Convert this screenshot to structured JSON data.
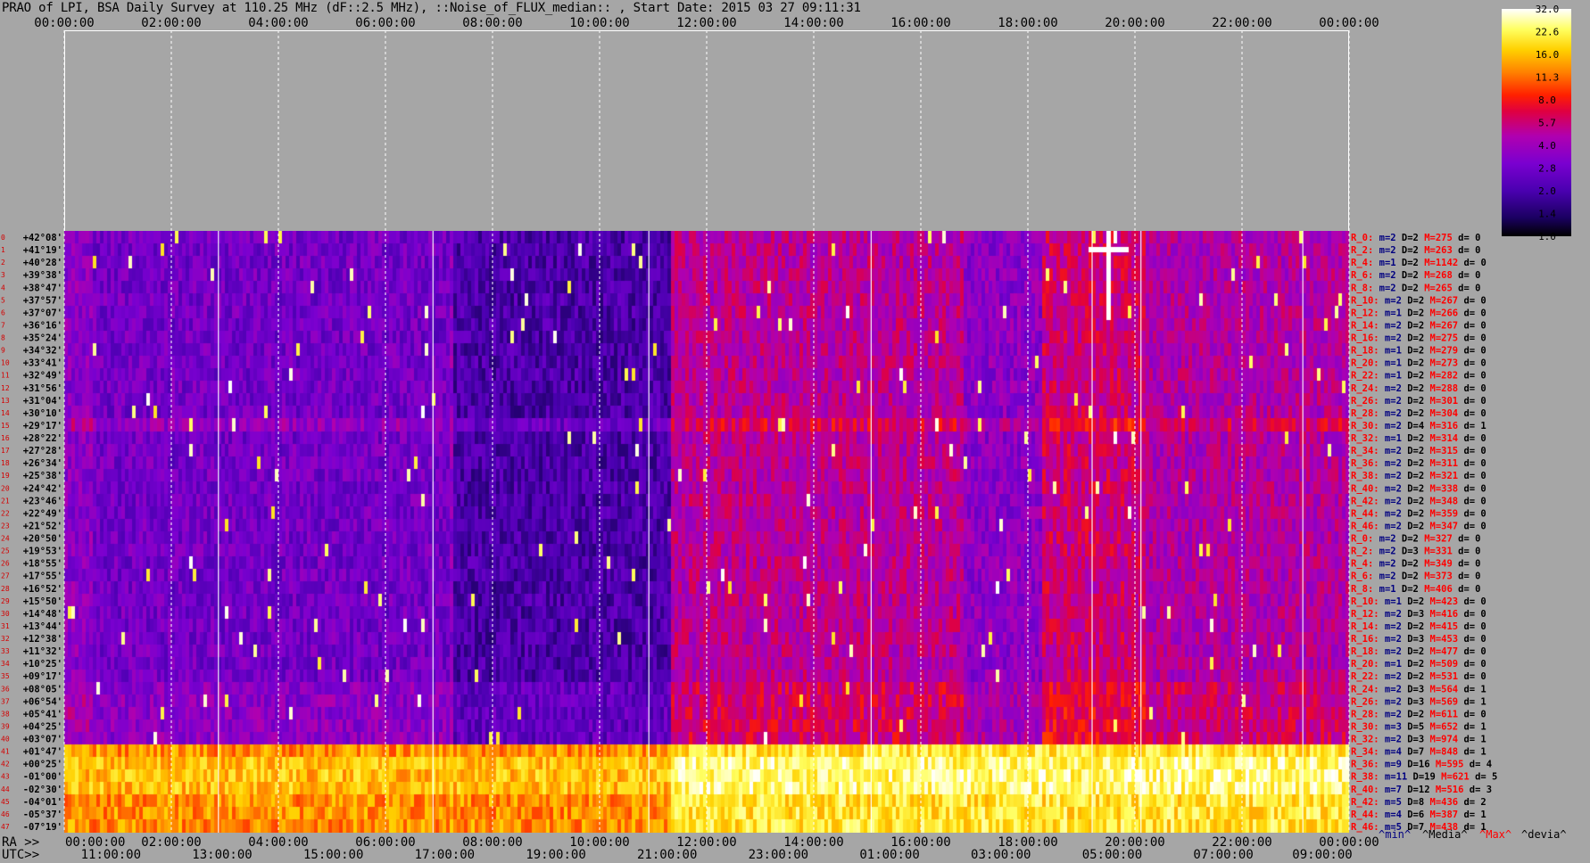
{
  "title": "PRAO of LPI, BSA Daily Survey at 110.25 MHz (dF::2.5 MHz), ::Noise_of_FLUX_median:: , Start Date: 2015 03 27 09:11:31",
  "top_time_ticks": [
    "00:00:00",
    "02:00:00",
    "04:00:00",
    "06:00:00",
    "08:00:00",
    "10:00:00",
    "12:00:00",
    "14:00:00",
    "16:00:00",
    "18:00:00",
    "20:00:00",
    "22:00:00",
    "00:00:00"
  ],
  "bottom_ra_prefix": "RA >>",
  "bottom_ra_ticks": [
    "00:00:00",
    "02:00:00",
    "04:00:00",
    "06:00:00",
    "08:00:00",
    "10:00:00",
    "12:00:00",
    "14:00:00",
    "16:00:00",
    "18:00:00",
    "20:00:00",
    "22:00:00",
    "00:00:00"
  ],
  "bottom_utc_prefix": "UTC>>",
  "bottom_utc_ticks": [
    "11:00:00",
    "13:00:00",
    "15:00:00",
    "17:00:00",
    "19:00:00",
    "21:00:00",
    "23:00:00",
    "01:00:00",
    "03:00:00",
    "05:00:00",
    "07:00:00",
    "09:00:00"
  ],
  "colorbar": {
    "ticks": [
      "32.0",
      "22.6",
      "16.0",
      "11.3",
      "8.0",
      "5.7",
      "4.0",
      "2.8",
      "2.0",
      "1.4",
      "1.0"
    ]
  },
  "legend": {
    "min": "^min^",
    "median": "^Media^",
    "max": "^Max^",
    "dev": "^devia^"
  },
  "colors": {
    "background": "#a6a6a6",
    "dec_labels": "#000000",
    "row_index": "#d40000",
    "stat_R": "#ff0000",
    "stat_m": "#000080",
    "stat_D": "#000000",
    "stat_M": "#ff0000"
  },
  "chart_data": {
    "type": "heatmap",
    "x_axis": "RA / UTC time (24h)",
    "colorbar_range": [
      1.0,
      32.0
    ],
    "colorbar_scale": "log2",
    "declinations": [
      "+42°08'",
      "+41°19'",
      "+40°28'",
      "+39°38'",
      "+38°47'",
      "+37°57'",
      "+37°07'",
      "+36°16'",
      "+35°24'",
      "+34°32'",
      "+33°41'",
      "+32°49'",
      "+31°56'",
      "+31°04'",
      "+30°10'",
      "+29°17'",
      "+28°22'",
      "+27°28'",
      "+26°34'",
      "+25°38'",
      "+24°42'",
      "+23°46'",
      "+22°49'",
      "+21°52'",
      "+20°50'",
      "+19°53'",
      "+18°55'",
      "+17°55'",
      "+16°52'",
      "+15°50'",
      "+14°48'",
      "+13°44'",
      "+12°38'",
      "+11°32'",
      "+10°25'",
      "+09°17'",
      "+08°05'",
      "+06°54'",
      "+05°41'",
      "+04°25'",
      "+03°07'",
      "+01°47'",
      "+00°25'",
      "-01°00'",
      "-02°30'",
      "-04°01'",
      "-05°37'",
      "-07°19'"
    ],
    "row_indices": [
      "0",
      "1",
      "2",
      "3",
      "4",
      "5",
      "6",
      "7",
      "8",
      "9",
      "10",
      "11",
      "12",
      "13",
      "14",
      "15",
      "16",
      "17",
      "18",
      "19",
      "20",
      "21",
      "22",
      "23",
      "24",
      "25",
      "26",
      "27",
      "28",
      "29",
      "30",
      "31",
      "32",
      "33",
      "34",
      "35",
      "36",
      "37",
      "38",
      "39",
      "40",
      "41",
      "42",
      "43",
      "44",
      "45",
      "46",
      "47"
    ],
    "row_stats": [
      {
        "r": "R_0:",
        "m": "m=2",
        "d": "D=2",
        "M": "M=275",
        "dv": "d= 0"
      },
      {
        "r": "R_2:",
        "m": "m=2",
        "d": "D=2",
        "M": "M=263",
        "dv": "d= 0"
      },
      {
        "r": "R_4:",
        "m": "m=1",
        "d": "D=2",
        "M": "M=1142",
        "dv": "d= 0"
      },
      {
        "r": "R_6:",
        "m": "m=2",
        "d": "D=2",
        "M": "M=268",
        "dv": "d= 0"
      },
      {
        "r": "R_8:",
        "m": "m=2",
        "d": "D=2",
        "M": "M=265",
        "dv": "d= 0"
      },
      {
        "r": "R_10:",
        "m": "m=2",
        "d": "D=2",
        "M": "M=267",
        "dv": "d= 0"
      },
      {
        "r": "R_12:",
        "m": "m=1",
        "d": "D=2",
        "M": "M=266",
        "dv": "d= 0"
      },
      {
        "r": "R_14:",
        "m": "m=2",
        "d": "D=2",
        "M": "M=267",
        "dv": "d= 0"
      },
      {
        "r": "R_16:",
        "m": "m=2",
        "d": "D=2",
        "M": "M=275",
        "dv": "d= 0"
      },
      {
        "r": "R_18:",
        "m": "m=1",
        "d": "D=2",
        "M": "M=279",
        "dv": "d= 0"
      },
      {
        "r": "R_20:",
        "m": "m=1",
        "d": "D=2",
        "M": "M=273",
        "dv": "d= 0"
      },
      {
        "r": "R_22:",
        "m": "m=1",
        "d": "D=2",
        "M": "M=282",
        "dv": "d= 0"
      },
      {
        "r": "R_24:",
        "m": "m=2",
        "d": "D=2",
        "M": "M=288",
        "dv": "d= 0"
      },
      {
        "r": "R_26:",
        "m": "m=2",
        "d": "D=2",
        "M": "M=301",
        "dv": "d= 0"
      },
      {
        "r": "R_28:",
        "m": "m=2",
        "d": "D=2",
        "M": "M=304",
        "dv": "d= 0"
      },
      {
        "r": "R_30:",
        "m": "m=2",
        "d": "D=4",
        "M": "M=316",
        "dv": "d= 1"
      },
      {
        "r": "R_32:",
        "m": "m=1",
        "d": "D=2",
        "M": "M=314",
        "dv": "d= 0"
      },
      {
        "r": "R_34:",
        "m": "m=2",
        "d": "D=2",
        "M": "M=315",
        "dv": "d= 0"
      },
      {
        "r": "R_36:",
        "m": "m=2",
        "d": "D=2",
        "M": "M=311",
        "dv": "d= 0"
      },
      {
        "r": "R_38:",
        "m": "m=2",
        "d": "D=2",
        "M": "M=321",
        "dv": "d= 0"
      },
      {
        "r": "R_40:",
        "m": "m=2",
        "d": "D=2",
        "M": "M=338",
        "dv": "d= 0"
      },
      {
        "r": "R_42:",
        "m": "m=2",
        "d": "D=2",
        "M": "M=348",
        "dv": "d= 0"
      },
      {
        "r": "R_44:",
        "m": "m=2",
        "d": "D=2",
        "M": "M=359",
        "dv": "d= 0"
      },
      {
        "r": "R_46:",
        "m": "m=2",
        "d": "D=2",
        "M": "M=347",
        "dv": "d= 0"
      },
      {
        "r": "R_0:",
        "m": "m=2",
        "d": "D=2",
        "M": "M=327",
        "dv": "d= 0"
      },
      {
        "r": "R_2:",
        "m": "m=2",
        "d": "D=3",
        "M": "M=331",
        "dv": "d= 0"
      },
      {
        "r": "R_4:",
        "m": "m=2",
        "d": "D=2",
        "M": "M=349",
        "dv": "d= 0"
      },
      {
        "r": "R_6:",
        "m": "m=2",
        "d": "D=2",
        "M": "M=373",
        "dv": "d= 0"
      },
      {
        "r": "R_8:",
        "m": "m=1",
        "d": "D=2",
        "M": "M=406",
        "dv": "d= 0"
      },
      {
        "r": "R_10:",
        "m": "m=1",
        "d": "D=2",
        "M": "M=423",
        "dv": "d= 0"
      },
      {
        "r": "R_12:",
        "m": "m=2",
        "d": "D=3",
        "M": "M=416",
        "dv": "d= 0"
      },
      {
        "r": "R_14:",
        "m": "m=2",
        "d": "D=2",
        "M": "M=415",
        "dv": "d= 0"
      },
      {
        "r": "R_16:",
        "m": "m=2",
        "d": "D=3",
        "M": "M=453",
        "dv": "d= 0"
      },
      {
        "r": "R_18:",
        "m": "m=2",
        "d": "D=2",
        "M": "M=477",
        "dv": "d= 0"
      },
      {
        "r": "R_20:",
        "m": "m=1",
        "d": "D=2",
        "M": "M=509",
        "dv": "d= 0"
      },
      {
        "r": "R_22:",
        "m": "m=2",
        "d": "D=2",
        "M": "M=531",
        "dv": "d= 0"
      },
      {
        "r": "R_24:",
        "m": "m=2",
        "d": "D=3",
        "M": "M=564",
        "dv": "d= 1"
      },
      {
        "r": "R_26:",
        "m": "m=2",
        "d": "D=3",
        "M": "M=569",
        "dv": "d= 1"
      },
      {
        "r": "R_28:",
        "m": "m=2",
        "d": "D=2",
        "M": "M=611",
        "dv": "d= 0"
      },
      {
        "r": "R_30:",
        "m": "m=3",
        "d": "D=5",
        "M": "M=652",
        "dv": "d= 1"
      },
      {
        "r": "R_32:",
        "m": "m=2",
        "d": "D=3",
        "M": "M=974",
        "dv": "d= 1"
      },
      {
        "r": "R_34:",
        "m": "m=4",
        "d": "D=7",
        "M": "M=848",
        "dv": "d= 1"
      },
      {
        "r": "R_36:",
        "m": "m=9",
        "d": "D=16",
        "M": "M=595",
        "dv": "d= 4"
      },
      {
        "r": "R_38:",
        "m": "m=11",
        "d": "D=19",
        "M": "M=621",
        "dv": "d= 5"
      },
      {
        "r": "R_40:",
        "m": "m=7",
        "d": "D=12",
        "M": "M=516",
        "dv": "d= 3"
      },
      {
        "r": "R_42:",
        "m": "m=5",
        "d": "D=8",
        "M": "M=436",
        "dv": "d= 2"
      },
      {
        "r": "R_44:",
        "m": "m=4",
        "d": "D=6",
        "M": "M=387",
        "dv": "d= 1"
      },
      {
        "r": "R_46:",
        "m": "m=5",
        "d": "D=7",
        "M": "M=438",
        "dv": "d= 1"
      }
    ]
  }
}
